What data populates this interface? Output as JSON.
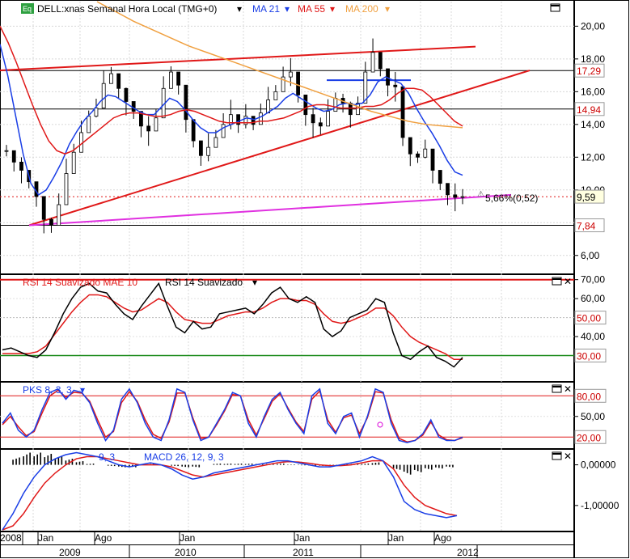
{
  "header": {
    "icon_label": "Eq",
    "symbol": "DELL:xnas Semanal Hora Local (TMG+0)",
    "ma21": "MA 21",
    "ma55": "MA 55",
    "ma200": "MA 200"
  },
  "rsi_header": {
    "title1": "RSI 14 Suavizado MAE 10",
    "title2": "RSI 14 Suavizado"
  },
  "pks_header": {
    "title": "PKS 8, 3, 3"
  },
  "macd_header": {
    "title1": "9, 3",
    "title2": "MACD 26, 12, 9, 3"
  },
  "annotations": {
    "gap": "5,66%(0,52)"
  },
  "chart_data": [
    {
      "type": "line",
      "panel": "price",
      "x_tick_labels": [
        "2008",
        "Jan",
        "Ago",
        "Jan",
        "Jan",
        "Jan",
        "Ago"
      ],
      "year_labels": [
        "2009",
        "2010",
        "2011",
        "2012"
      ],
      "y_ticks": [
        "20,00",
        "18,00",
        "16,00",
        "14,00",
        "12,00",
        "10,00",
        "8,00",
        "6,00"
      ],
      "y_tick_values": [
        20,
        18,
        16,
        14,
        12,
        10,
        8,
        6
      ],
      "ylim": [
        5,
        21.5
      ],
      "series": [
        {
          "name": "DELL",
          "values": [
            12.4,
            11.7,
            11.2,
            10.5,
            9.6,
            8.2,
            7.84,
            9.1,
            11.0,
            12.3,
            13.5,
            14.5,
            15.0,
            16.5,
            17.1,
            16.2,
            15.4,
            14.8,
            13.9,
            13.6,
            14.4,
            16.2,
            17.2,
            16.4,
            14.3,
            13.0,
            12.1,
            12.6,
            13.2,
            14.0,
            14.6,
            14.0,
            14.5,
            14.0,
            14.7,
            15.5,
            16.0,
            16.9,
            17.2,
            15.8,
            14.6,
            14.1,
            13.9,
            14.8,
            15.6,
            15.3,
            14.6,
            15.3,
            17.2,
            18.4,
            17.4,
            16.4,
            16.3,
            13.2,
            12.2,
            12.0,
            12.5,
            11.2,
            10.4,
            9.7,
            9.55,
            9.59
          ]
        },
        {
          "name": "MA 21",
          "values": [
            18.9,
            17.0,
            14.6,
            12.2,
            10.4,
            9.7,
            10.0,
            10.8,
            11.7,
            12.8,
            13.6,
            14.3,
            14.8,
            15.4,
            15.8,
            15.7,
            15.4,
            15.1,
            14.8,
            14.6,
            14.6,
            15.1,
            15.6,
            15.4,
            14.9,
            14.3,
            13.8,
            13.5,
            13.5,
            13.8,
            14.0,
            14.2,
            14.4,
            14.3,
            14.5,
            14.8,
            15.1,
            15.6,
            15.9,
            15.6,
            15.3,
            15.0,
            14.8,
            14.9,
            15.2,
            15.3,
            15.2,
            15.3,
            15.8,
            16.6,
            16.9,
            16.7,
            16.5,
            15.9,
            15.0,
            14.2,
            13.5,
            12.7,
            11.8,
            11.1,
            10.9
          ]
        },
        {
          "name": "MA 55",
          "values": [
            20.0,
            19.0,
            17.8,
            16.5,
            15.2,
            14.0,
            13.0,
            12.4,
            12.2,
            12.4,
            12.8,
            13.2,
            13.6,
            14.0,
            14.4,
            14.6,
            14.7,
            14.7,
            14.6,
            14.5,
            14.5,
            14.6,
            14.8,
            14.9,
            14.8,
            14.6,
            14.4,
            14.2,
            14.1,
            14.1,
            14.1,
            14.1,
            14.2,
            14.2,
            14.3,
            14.4,
            14.6,
            14.8,
            15.1,
            15.2,
            15.2,
            15.1,
            15.0,
            15.0,
            15.0,
            15.1,
            15.1,
            15.2,
            15.5,
            15.9,
            16.2,
            16.2,
            16.1,
            15.7,
            15.2,
            14.7,
            14.2,
            13.9
          ]
        },
        {
          "name": "MA 200",
          "values": [
            21.5,
            20.9,
            20.3,
            19.8,
            19.3,
            18.8,
            18.4,
            18.0,
            17.6,
            17.2,
            16.8,
            16.4,
            16.0,
            15.6,
            15.2,
            14.8,
            14.5,
            14.2,
            14.0,
            13.9,
            13.8
          ]
        }
      ],
      "horizontal_levels": [
        {
          "value": 17.29,
          "label": "17,29",
          "color": "#cc0000"
        },
        {
          "value": 14.94,
          "label": "14,94",
          "color": "#cc0000"
        },
        {
          "value": 9.59,
          "label": "9,59",
          "color": "#000000"
        },
        {
          "value": 7.84,
          "label": "7,84",
          "color": "#cc0000"
        }
      ],
      "colors": {
        "price": "#000000",
        "ma21": "#1a3ee6",
        "ma55": "#e01818",
        "ma200": "#f0a040",
        "channel": "#e01818",
        "support": "#e030e0",
        "box": "#1a3ee6"
      }
    },
    {
      "type": "line",
      "panel": "rsi",
      "y_ticks": [
        "70,00",
        "60,00",
        "50,00",
        "40,00",
        "30,00"
      ],
      "y_tick_values": [
        70,
        60,
        50,
        40,
        30
      ],
      "ylim": [
        17,
        72
      ],
      "levels": [
        {
          "value": 50,
          "label": "50,00",
          "color": "#cc0000"
        },
        {
          "value": 30,
          "label": "30,00",
          "color": "#cc0000"
        }
      ],
      "series": [
        {
          "name": "RSI 14 Suavizado",
          "values": [
            33,
            34,
            32,
            30,
            29,
            33,
            42,
            52,
            60,
            66,
            68,
            64,
            63,
            57,
            52,
            49,
            56,
            62,
            68,
            56,
            45,
            42,
            48,
            44,
            45,
            52,
            53,
            54,
            55,
            52,
            57,
            63,
            66,
            60,
            58,
            61,
            58,
            44,
            40,
            43,
            50,
            52,
            54,
            60,
            58,
            42,
            30,
            28,
            32,
            35,
            29,
            27,
            24,
            29
          ]
        },
        {
          "name": "RSI 14 Suavizado MAE 10",
          "values": [
            31,
            31,
            31,
            31,
            32,
            35,
            41,
            47,
            53,
            58,
            62,
            62,
            61,
            58,
            55,
            53,
            54,
            57,
            60,
            58,
            53,
            49,
            48,
            47,
            47,
            49,
            51,
            52,
            53,
            53,
            55,
            58,
            60,
            60,
            59,
            59,
            57,
            52,
            48,
            47,
            48,
            50,
            52,
            55,
            55,
            51,
            45,
            40,
            37,
            35,
            33,
            31,
            28,
            28
          ]
        }
      ]
    },
    {
      "type": "line",
      "panel": "pks",
      "y_ticks": [
        "80,00",
        "50,00",
        "20,00"
      ],
      "y_tick_values": [
        80,
        50,
        20
      ],
      "ylim": [
        5,
        98
      ],
      "levels": [
        {
          "value": 80,
          "label": "80,00",
          "color": "#cc0000"
        },
        {
          "value": 20,
          "label": "20,00",
          "color": "#cc0000"
        }
      ],
      "series": [
        {
          "name": "PKS 8",
          "values": [
            40,
            55,
            30,
            20,
            30,
            60,
            85,
            90,
            75,
            88,
            85,
            70,
            40,
            15,
            30,
            75,
            90,
            70,
            40,
            20,
            15,
            45,
            90,
            85,
            45,
            15,
            20,
            40,
            60,
            85,
            80,
            40,
            20,
            50,
            75,
            85,
            60,
            40,
            25,
            80,
            90,
            40,
            25,
            50,
            55,
            20,
            50,
            90,
            85,
            40,
            15,
            12,
            15,
            25,
            45,
            20,
            15,
            15,
            20
          ]
        },
        {
          "name": "3",
          "values": [
            38,
            50,
            35,
            22,
            28,
            55,
            80,
            88,
            78,
            85,
            84,
            72,
            45,
            20,
            28,
            70,
            86,
            72,
            45,
            24,
            18,
            42,
            84,
            84,
            48,
            18,
            20,
            38,
            58,
            82,
            80,
            45,
            23,
            47,
            72,
            83,
            62,
            42,
            28,
            75,
            87,
            45,
            27,
            48,
            52,
            25,
            48,
            86,
            84,
            45,
            18,
            13,
            15,
            23,
            42,
            23,
            16,
            15,
            19
          ]
        }
      ]
    },
    {
      "type": "line",
      "panel": "macd",
      "y_ticks": [
        "0,00000",
        "-1,00000"
      ],
      "y_tick_values": [
        0,
        -1
      ],
      "ylim": [
        -1.6,
        0.35
      ],
      "series": [
        {
          "name": "MACD 26, 12",
          "values": [
            -1.6,
            -1.2,
            -0.7,
            -0.3,
            0.0,
            0.15,
            0.25,
            0.3,
            0.25,
            0.2,
            0.1,
            0.0,
            -0.05,
            0.0,
            0.05,
            0.0,
            -0.1,
            -0.25,
            -0.35,
            -0.3,
            -0.2,
            -0.15,
            -0.1,
            -0.05,
            0.0,
            0.05,
            0.1,
            0.1,
            0.05,
            0.0,
            -0.05,
            -0.05,
            0.0,
            0.05,
            0.1,
            0.2,
            0.1,
            -0.3,
            -0.9,
            -1.1,
            -1.2,
            -1.25,
            -1.3,
            -1.25
          ]
        },
        {
          "name": "9",
          "values": [
            -1.6,
            -1.5,
            -1.2,
            -0.8,
            -0.45,
            -0.2,
            0.0,
            0.15,
            0.2,
            0.2,
            0.15,
            0.1,
            0.05,
            0.0,
            0.0,
            0.0,
            -0.05,
            -0.15,
            -0.25,
            -0.3,
            -0.25,
            -0.2,
            -0.15,
            -0.1,
            -0.05,
            0.0,
            0.05,
            0.08,
            0.07,
            0.04,
            0.0,
            -0.02,
            -0.02,
            0.0,
            0.05,
            0.1,
            0.1,
            -0.1,
            -0.5,
            -0.8,
            -1.0,
            -1.1,
            -1.2,
            -1.25
          ]
        }
      ]
    }
  ]
}
